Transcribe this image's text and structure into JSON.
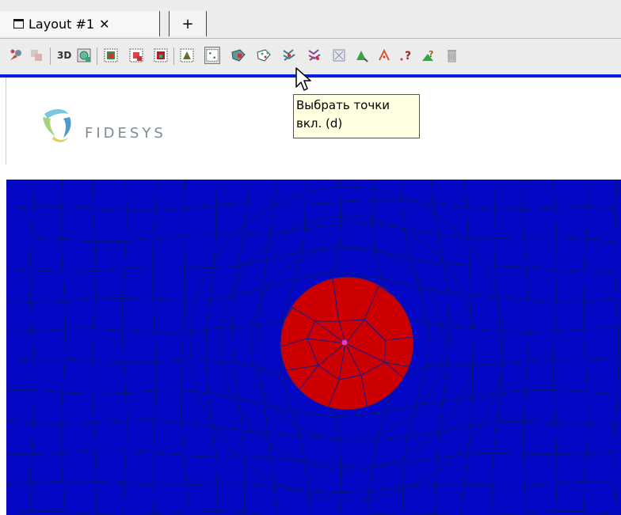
{
  "tabs": {
    "active": {
      "label": "Layout #1",
      "close_glyph": "✕",
      "icon": "window-icon"
    },
    "add": {
      "label": "+"
    }
  },
  "toolbar": {
    "text_3d": "3D",
    "active_tool": "select-points-icon",
    "tooltip": {
      "line1": "Выбрать точки",
      "line2": "вкл. (d)"
    }
  },
  "logo": {
    "text": "FIDESYS",
    "colors": [
      "#6cc0d8",
      "#9ccf6b",
      "#e0c84b",
      "#3d8fc7"
    ]
  },
  "viewport": {
    "background": "#0408c4",
    "grid_line_color": "#001a6e",
    "selection_color": "#cc0000",
    "selected_point_color": "#e03ccc"
  }
}
